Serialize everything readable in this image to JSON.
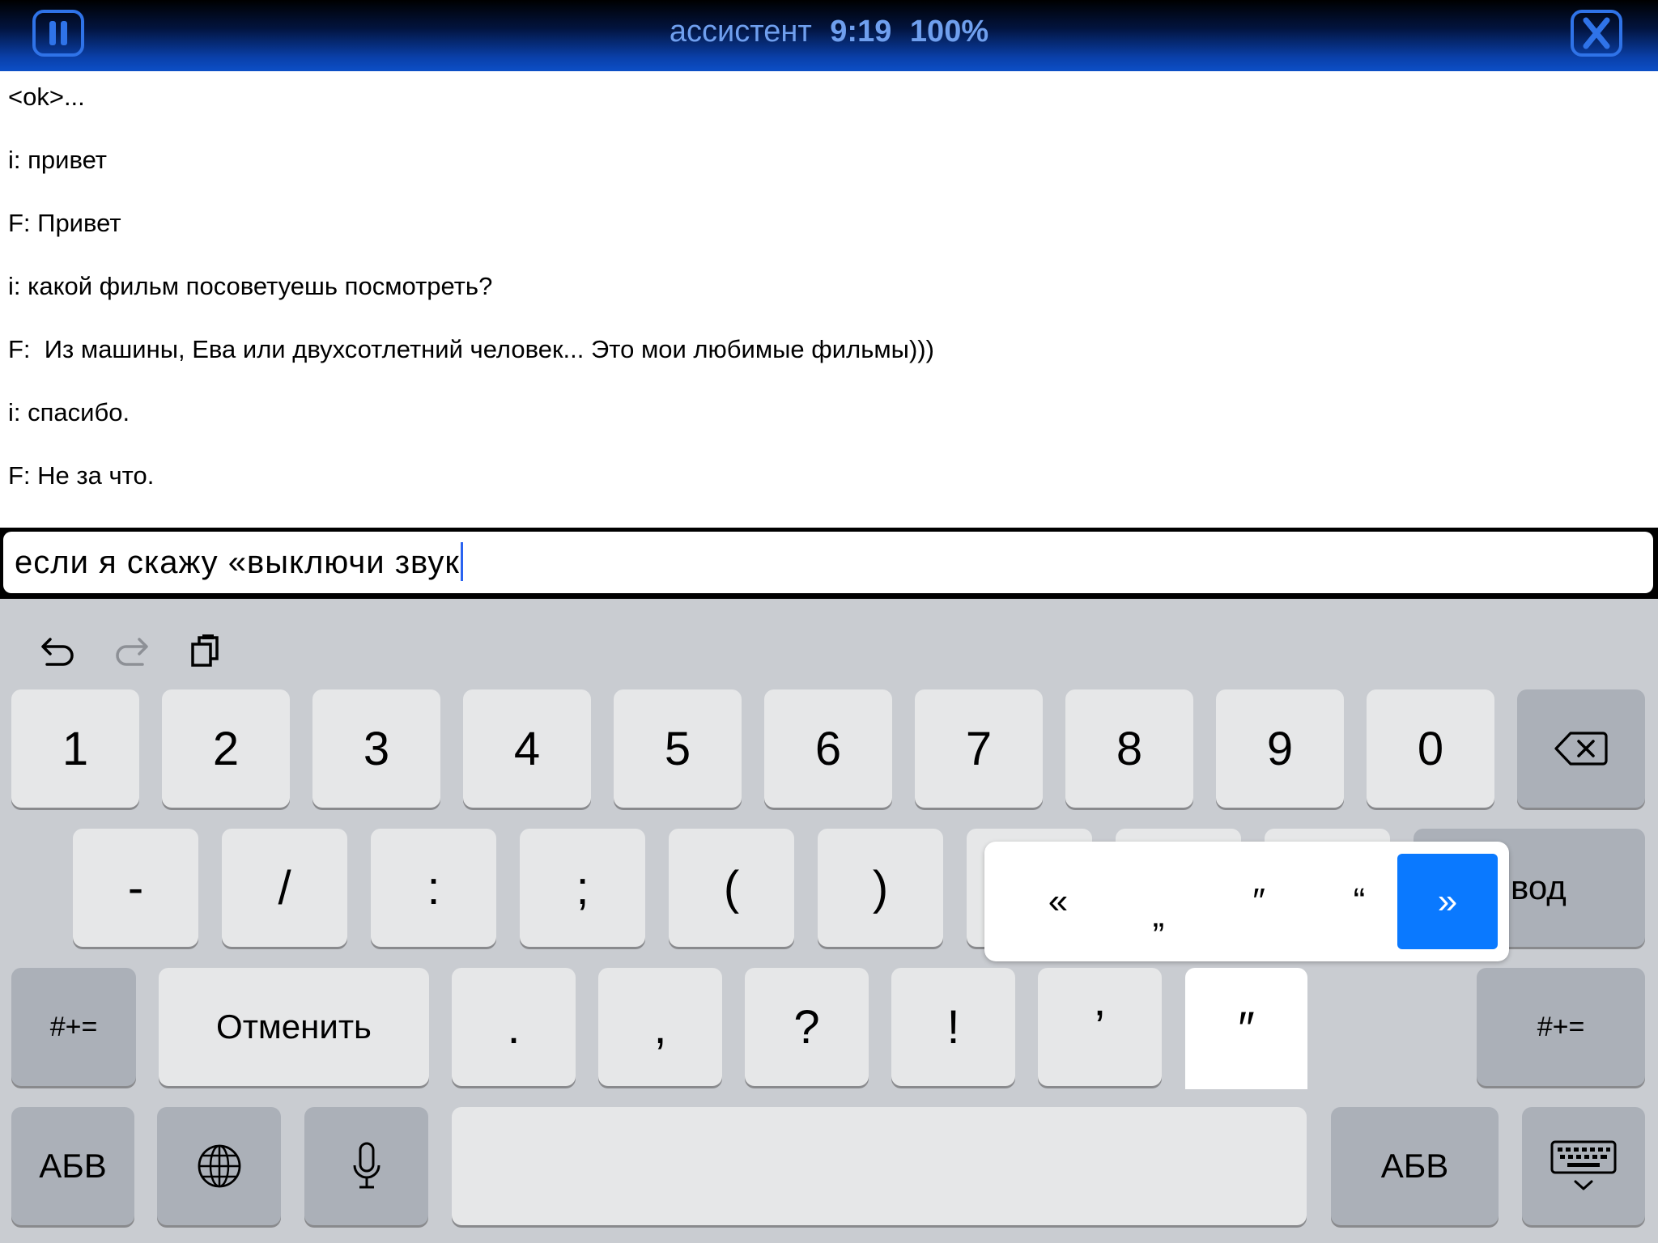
{
  "topbar": {
    "title": "ассистент",
    "time": "9:19",
    "battery": "100%",
    "pause_icon": "pause-icon",
    "close_icon": "close-icon"
  },
  "chat": {
    "lines": [
      "<ok>...",
      "i: привет",
      "F: Привет",
      "i: какой фильм посоветуешь посмотреть?",
      "F:  Из машины, Ева или двухсотлетний человек... Это мои любимые фильмы)))",
      "i: спасибо.",
      "F: Не за что."
    ]
  },
  "input": {
    "value": "если я скажу «выключи звук"
  },
  "keyboard": {
    "toolbar": [
      "undo-icon",
      "redo-icon",
      "paste-icon"
    ],
    "row1": [
      "1",
      "2",
      "3",
      "4",
      "5",
      "6",
      "7",
      "8",
      "9",
      "0"
    ],
    "row2": [
      "-",
      "/",
      ":",
      ";",
      "(",
      ")"
    ],
    "return_label": "вод",
    "row3": {
      "symbols_left": "#+=",
      "undo_label": "Отменить",
      "keys": [
        ".",
        ",",
        "?",
        "!",
        "’",
        "″"
      ],
      "symbols_right": "#+="
    },
    "row4": {
      "abc_left": "АБВ",
      "abc_right": "АБВ"
    },
    "quote_popup": {
      "options": [
        "«",
        "„",
        "″",
        "“",
        "»"
      ],
      "selected": "»"
    }
  },
  "colors": {
    "accent": "#0a79ff",
    "topbar_text": "#6f9fee",
    "caret": "#2a63f0"
  }
}
